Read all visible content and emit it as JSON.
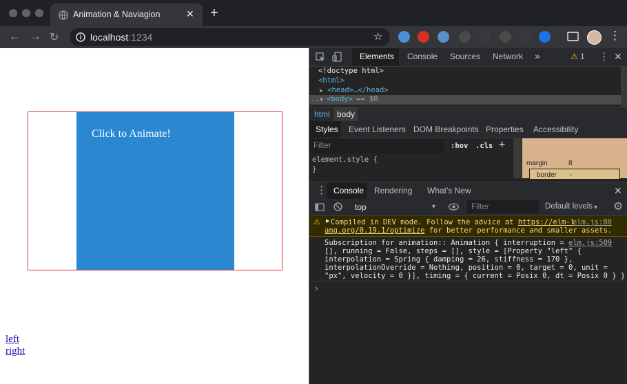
{
  "browser": {
    "tab_title": "Animation & Naviagion",
    "url_host": "localhost",
    "url_port": ":1234"
  },
  "page": {
    "animate_label": "Click to Animate!",
    "links": [
      {
        "label": "left"
      },
      {
        "label": "right"
      }
    ]
  },
  "devtools": {
    "tabs": [
      "Elements",
      "Console",
      "Sources",
      "Network"
    ],
    "more_tabs": "»",
    "warning_count": "1",
    "dom": {
      "doctype": "<!doctype html>",
      "html_open": "<html>",
      "head": "<head>…</head>",
      "body": "<body>",
      "body_suffix": "== $0"
    },
    "breadcrumbs": [
      "html",
      "body"
    ],
    "styles_tabs": [
      "Styles",
      "Event Listeners",
      "DOM Breakpoints",
      "Properties",
      "Accessibility"
    ],
    "filter_placeholder": "Filter",
    "hov": ":hov",
    "cls": ".cls",
    "element_style": "element.style {",
    "element_style_close": "}",
    "box_model": {
      "margin_label": "margin",
      "margin_value": "8",
      "border_label": "border",
      "border_value": "-"
    },
    "drawer_tabs": [
      "Console",
      "Rendering",
      "What's New"
    ],
    "context": "top",
    "console_filter_placeholder": "Filter",
    "levels": "Default levels",
    "messages": {
      "warning": {
        "line1": "Compiled in DEV mode. Follow the advice at",
        "link_part1": "https://elm-l",
        "link_part2": "ang.org/0.19.1/optimize",
        "line2_rest": "for better performance and smaller assets.",
        "source": "elm.js:80"
      },
      "log": {
        "lines": [
          "Subscription for animation:: Animation { interruption =",
          "[], running = False, steps = [], style = [Property \"left\" {",
          "interpolation = Spring { damping = 26, stiffness = 170 },",
          "interpolationOverride = Nothing, position = 0, target = 0, unit =",
          "\"px\", velocity = 0 }], timing = { current = Posix 0, dt = Posix 0 } }"
        ],
        "source": "elm.js:509"
      }
    },
    "prompt": "›"
  },
  "colors": {
    "anim_box": "#2a88d3",
    "outer_border": "#e03030",
    "devtools_bg": "#242424",
    "warning_bg": "#332b00"
  }
}
